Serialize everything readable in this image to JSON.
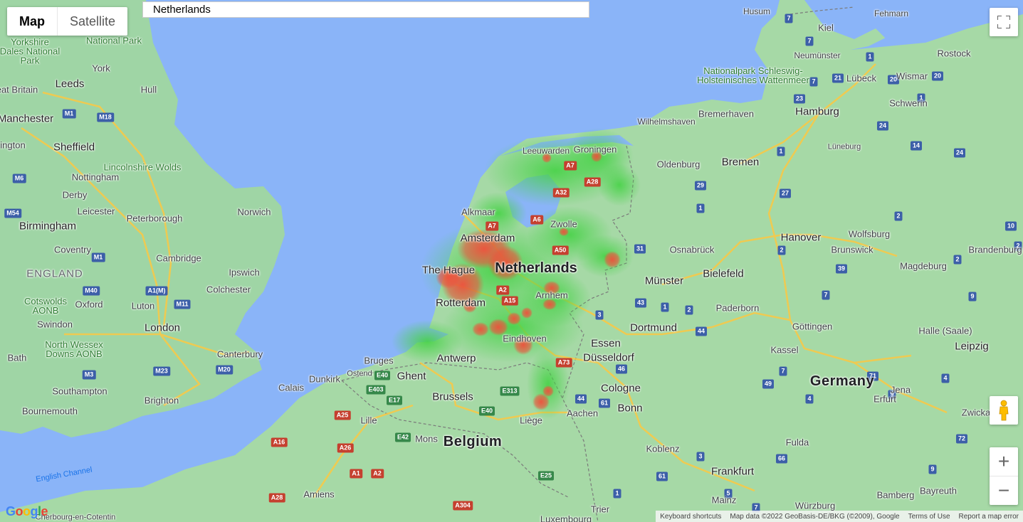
{
  "map_type": {
    "map_label": "Map",
    "satellite_label": "Satellite"
  },
  "search": {
    "value": "Netherlands"
  },
  "labels": {
    "north_sea_coast": "",
    "yorkshire_dales": "Yorkshire Dales National Park",
    "national_park": "National Park",
    "york": "York",
    "leeds": "Leeds",
    "hull": "Hull",
    "great_britain": "eat Britain",
    "manchester": "Manchester",
    "sheffield": "Sheffield",
    "ington": "ington",
    "nottingham": "Nottingham",
    "derby": "Derby",
    "lincolnshire": "Lincolnshire Wolds",
    "leicester": "Leicester",
    "peterborough": "Peterborough",
    "norwich": "Norwich",
    "birmingham": "Birmingham",
    "coventry": "Coventry",
    "cambridge": "Cambridge",
    "ipswich": "Ipswich",
    "england": "ENGLAND",
    "colchester": "Colchester",
    "cotswolds": "Cotswolds AONB",
    "oxford": "Oxford",
    "luton": "Luton",
    "swindon": "Swindon",
    "london": "London",
    "north_wessex": "North Wessex Downs AONB",
    "bath": "Bath",
    "canterbury": "Canterbury",
    "southampton": "Southampton",
    "brighton": "Brighton",
    "bournemouth": "Bournemouth",
    "english_channel": "English Channel",
    "cherbourg": "Cherbourg-en-Cotentin",
    "calais": "Calais",
    "dunkirk": "Dunkirk",
    "bruges": "Bruges",
    "ostend": "Ostend",
    "ghent": "Ghent",
    "antwerp": "Antwerp",
    "brussels": "Brussels",
    "lille": "Lille",
    "mons": "Mons",
    "belgium": "Belgium",
    "liege": "Liège",
    "amiens": "Amiens",
    "luxembourg": "Luxembourg",
    "the_hague": "The Hague",
    "rotterdam": "Rotterdam",
    "amsterdam": "Amsterdam",
    "netherlands": "Netherlands",
    "alkmaar": "Alkmaar",
    "leeuwarden": "Leeuwarden",
    "groningen": "Groningen",
    "zwolle": "Zwolle",
    "arnhem": "Arnhem",
    "eindhoven": "Eindhoven",
    "aachen": "Aachen",
    "essen": "Essen",
    "dusseldorf": "Düsseldorf",
    "cologne": "Cologne",
    "bonn": "Bonn",
    "dortmund": "Dortmund",
    "munster": "Münster",
    "osnabruck": "Osnabrück",
    "bielefeld": "Bielefeld",
    "paderborn": "Paderborn",
    "hanover": "Hanover",
    "wolfsburg": "Wolfsburg",
    "brunswick": "Brunswick",
    "gottingen": "Göttingen",
    "kassel": "Kassel",
    "magdeburg": "Magdeburg",
    "halle": "Halle (Saale)",
    "leipzig": "Leipzig",
    "germany": "Germany",
    "jena": "Jena",
    "erfurt": "Erfurt",
    "zwicka": "Zwicka",
    "koblenz": "Koblenz",
    "fulda": "Fulda",
    "frankfurt": "Frankfurt",
    "mainz": "Mainz",
    "trier": "Trier",
    "bayreuth": "Bayreuth",
    "bamberg": "Bamberg",
    "wurzburg": "Würzburg",
    "bremen": "Bremen",
    "oldenburg": "Oldenburg",
    "bremerhaven": "Bremerhaven",
    "wilhelmshaven": "Wilhelmshaven",
    "hamburg": "Hamburg",
    "luneburg": "Lüneburg",
    "schwerin": "Schwerin",
    "lubeck": "Lübeck",
    "wismar": "Wismar",
    "rostock": "Rostock",
    "kiel": "Kiel",
    "neumunster": "Neumünster",
    "husum": "Husum",
    "fehmarn": "Fehmarn",
    "wattenmeer": "Nationalpark Schleswig-Holsteinisches Wattenmeer",
    "brandenburg": "Brandenburg"
  },
  "controls": {
    "fullscreen_icon": "fullscreen-icon",
    "pegman_icon": "pegman-icon",
    "zoom_in_label": "+",
    "zoom_out_label": "−"
  },
  "footer": {
    "google_logo": "Google",
    "keyboard_shortcuts": "Keyboard shortcuts",
    "map_data": "Map data ©2022 GeoBasis-DE/BKG (©2009), Google",
    "terms": "Terms of Use",
    "report": "Report a map error"
  },
  "colors": {
    "water": "#8ab4f8",
    "land": "#9fd5a5",
    "heat_green": "#46d246",
    "heat_red": "#f0503c"
  }
}
